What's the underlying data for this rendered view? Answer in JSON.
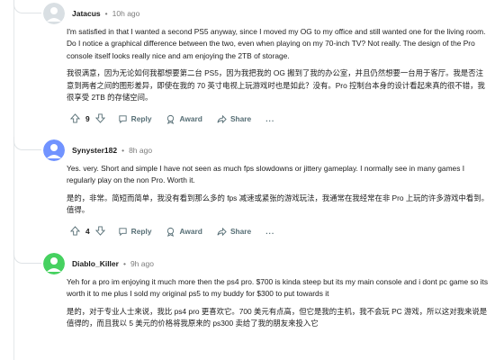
{
  "comments": [
    {
      "username": "Jatacus",
      "time": "10h ago",
      "avatar_color": "#d9dfe3",
      "text_en": "I'm satisfied in that I wanted a second PS5 anyway, since I moved my OG to my office and still wanted one for the living room. Do I notice a graphical difference between the two, even when playing on my 70-inch TV? Not really. The design of the Pro console itself looks really nice and am enjoying the 2TB of storage.",
      "text_zh": "我很满意，因为无论如何我都想要第二台 PS5，因为我把我的 OG 搬到了我的办公室，并且仍然想要一台用于客厅。我是否注意到两者之间的图形差异，即使在我的 70 英寸电视上玩游戏时也是如此？没有。Pro 控制台本身的设计看起来真的很不错，我很享受 2TB 的存储空间。",
      "votes": "9",
      "reply_label": "Reply",
      "award_label": "Award",
      "share_label": "Share",
      "more_label": "..."
    },
    {
      "username": "Synyster182",
      "time": "8h ago",
      "avatar_color": "#7193ff",
      "text_en": "Yes. very. Short and simple I have not seen as much fps slowdowns or jittery gameplay. I normally see in many games I regularly play on the non Pro. Worth it.",
      "text_zh": "是的，非常。简短而简单，我没有看到那么多的 fps 减速或紧张的游戏玩法，我通常在我经常在非 Pro 上玩的许多游戏中看到。值得。",
      "votes": "4",
      "reply_label": "Reply",
      "award_label": "Award",
      "share_label": "Share",
      "more_label": "..."
    },
    {
      "username": "Diablo_Killer",
      "time": "9h ago",
      "avatar_color": "#46d160",
      "text_en": "Yeh for a pro im enjoying it much more then the ps4 pro. $700 is kinda steep but its my main console and i dont pc game so its worth it to me plus I sold my original ps5 to my buddy for $300 to put towards it",
      "text_zh": "是的，对于专业人士来说，我比 ps4 pro 更喜欢它。700 美元有点高，但它是我的主机，我不会玩 PC 游戏，所以这对我来说是值得的，而且我以 5 美元的价格将我原来的 ps300 卖给了我的朋友来投入它",
      "votes": "",
      "reply_label": "",
      "award_label": "",
      "share_label": "",
      "more_label": ""
    }
  ]
}
